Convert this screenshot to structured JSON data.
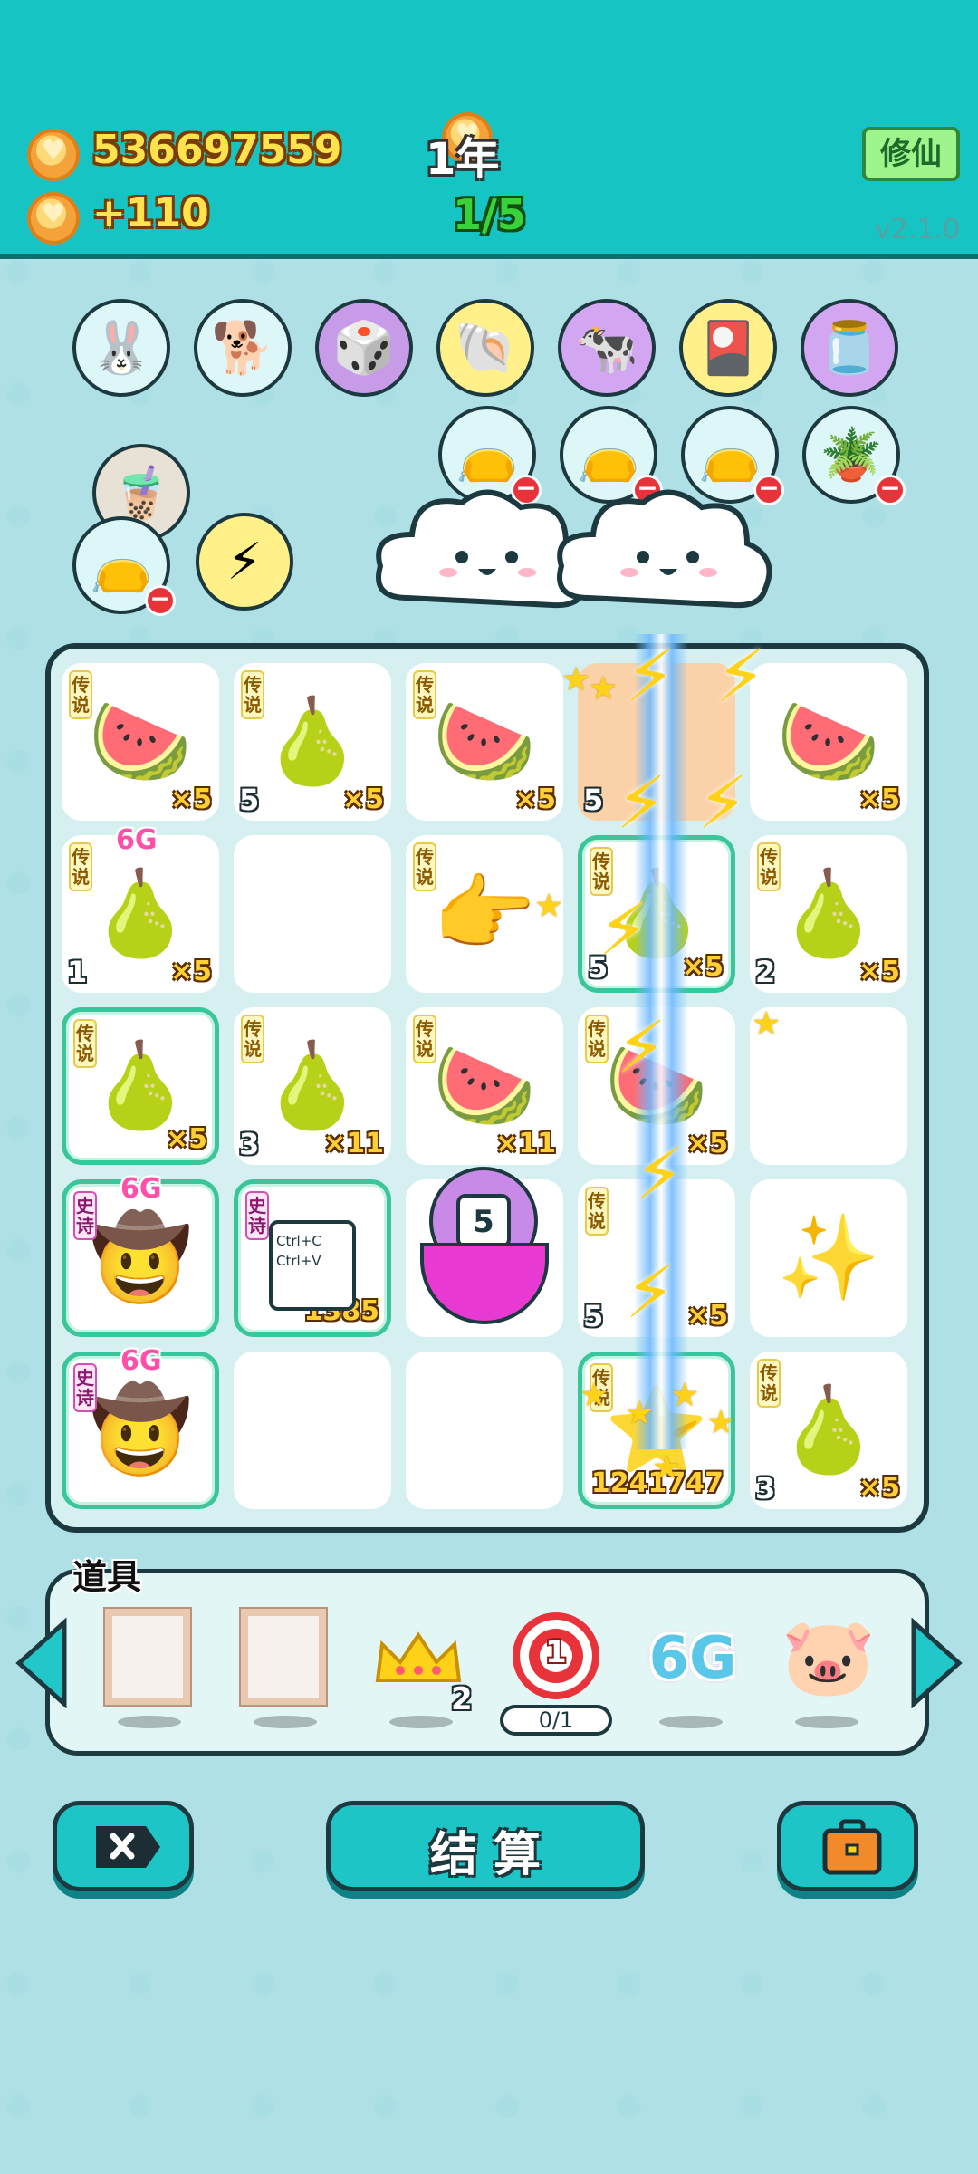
{
  "header": {
    "gold": "536697559",
    "income": "+110",
    "year": "1年",
    "stage": "1/5",
    "cultivate_label": "修仙",
    "version": "v2.1.0"
  },
  "relics_row1": [
    {
      "name": "rabbit-relic",
      "icon": "🐰",
      "bg": "#ddf6f8"
    },
    {
      "name": "dog-relic",
      "icon": "🐕",
      "bg": "#ddf6f8"
    },
    {
      "name": "multiplier-relic",
      "icon": "🎲",
      "bg": "#c89be8"
    },
    {
      "name": "shell-relic",
      "icon": "🐚",
      "bg": "#fff08a"
    },
    {
      "name": "cows-relic",
      "icon": "🐄",
      "bg": "#d2a6f0"
    },
    {
      "name": "card-pack-relic",
      "icon": "🎴",
      "bg": "#fff08a"
    },
    {
      "name": "jar-relic",
      "icon": "🫙",
      "bg": "#d2a6f0"
    }
  ],
  "relics_row2": [
    {
      "name": "bag-relic-1",
      "icon": "👝"
    },
    {
      "name": "bag-relic-2",
      "icon": "👝"
    },
    {
      "name": "bag-relic-3",
      "icon": "👝"
    },
    {
      "name": "flower-pot-relic",
      "icon": "🪴"
    }
  ],
  "grid": [
    [
      {
        "tag": "传说",
        "icon": "🍉",
        "count": "×5"
      },
      {
        "tag": "传说",
        "icon": "🍐",
        "count": "×5",
        "level": "5"
      },
      {
        "tag": "传说",
        "icon": "🍉",
        "count": "×5"
      },
      {
        "icon": "",
        "level": "5"
      },
      {
        "icon": "🍉",
        "count": "×5"
      }
    ],
    [
      {
        "tag": "传说",
        "icon": "🍐",
        "count": "×5",
        "level": "1",
        "sixg": "6G"
      },
      {},
      {
        "tag": "传说",
        "icon": "👉"
      },
      {
        "tag": "传说",
        "icon": "🍐",
        "count": "×5",
        "level": "5"
      },
      {
        "tag": "传说",
        "icon": "🍐",
        "count": "×5",
        "level": "2"
      }
    ],
    [
      {
        "tag": "传说",
        "icon": "🍐",
        "count": "×5"
      },
      {
        "tag": "传说",
        "icon": "🍐",
        "count": "×11",
        "level": "3"
      },
      {
        "tag": "传说",
        "icon": "🍉",
        "count": "×11"
      },
      {
        "tag": "传说",
        "icon": "🍉",
        "count": "×5"
      },
      {}
    ],
    [
      {
        "tag": "史诗",
        "icon": "🤠",
        "sixg": "6G",
        "tagColor": "pink"
      },
      {
        "tag": "史诗",
        "icon": "📋",
        "count": "1385",
        "tagColor": "pink"
      },
      {
        "icon": "",
        "calendar": "5"
      },
      {
        "tag": "传说",
        "icon": "",
        "count": "×5",
        "level": "5"
      },
      {
        "icon": "✨"
      }
    ],
    [
      {
        "tag": "史诗",
        "icon": "🤠",
        "sixg": "6G",
        "tagColor": "pink"
      },
      {},
      {},
      {
        "tag": "传说",
        "icon": "⭐",
        "count": "1241747"
      },
      {
        "tag": "传说",
        "icon": "🍐",
        "count": "×5",
        "level": "3"
      }
    ]
  ],
  "copy_card": {
    "line1": "Ctrl+C",
    "line2": "Ctrl+V"
  },
  "items": {
    "label": "道具",
    "crown_count": "2",
    "target_value": "1",
    "target_progress": "0/1",
    "sixg_label": "6G"
  },
  "buttons": {
    "settle": "结 算"
  },
  "colors": {
    "header": "#17c4c4",
    "background": "#aee0e6",
    "accent": "#1dc5c7",
    "gold_text": "#ffe34d"
  }
}
